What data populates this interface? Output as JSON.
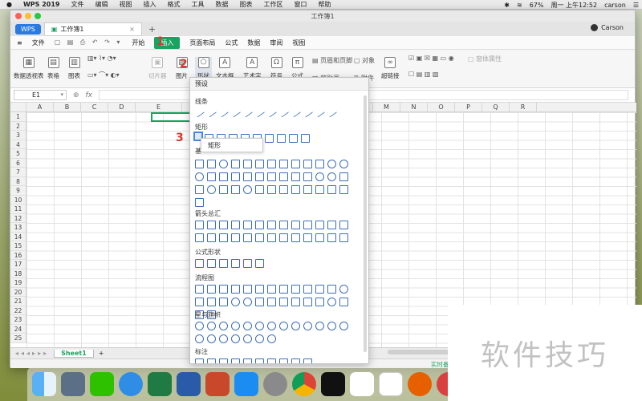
{
  "menubar": {
    "app": "WPS 2019",
    "items": [
      "文件",
      "编辑",
      "视图",
      "插入",
      "格式",
      "工具",
      "数据",
      "图表",
      "工作区",
      "窗口",
      "帮助"
    ],
    "battery": "67%",
    "datetime": "周一 上午12:52",
    "user": "carson"
  },
  "window": {
    "title": "工作簿1",
    "tabs": {
      "wps": "WPS",
      "doc": "工作簿1"
    },
    "user": "Carson"
  },
  "ribbon_tabs": {
    "file": "文件",
    "items": [
      "开始",
      "插入",
      "页面布局",
      "公式",
      "数据",
      "审阅",
      "视图"
    ],
    "active": "插入"
  },
  "ribbon": {
    "pivot": "数据透视表",
    "table": "表格",
    "chart": "图表",
    "slicer": "切片器",
    "picture": "图片",
    "shapes": "形状",
    "textbox": "文本框",
    "wordart": "艺术字",
    "symbol": "符号",
    "formula": "公式",
    "header_footer": "页眉和页脚",
    "object": "对象",
    "attach": "附件",
    "hyperlink": "超链接",
    "window_props": "窗体属性",
    "sticker": "剪贴画"
  },
  "formula_bar": {
    "name_box": "E1",
    "fx": "fx"
  },
  "grid": {
    "columns": [
      "A",
      "B",
      "C",
      "D",
      "E",
      "F",
      "G",
      "H",
      "I",
      "J",
      "K",
      "L",
      "M",
      "N",
      "O",
      "P",
      "Q",
      "R"
    ],
    "rows": [
      "1",
      "2",
      "3",
      "4",
      "5",
      "6",
      "7",
      "8",
      "9",
      "10",
      "11",
      "12",
      "13",
      "14",
      "15",
      "16",
      "17",
      "18",
      "19",
      "20",
      "21",
      "22",
      "23",
      "24",
      "25"
    ]
  },
  "sheets": {
    "active": "Sheet1"
  },
  "status": {
    "save": "实时备份"
  },
  "shapes_popup": {
    "header": "预设",
    "sections": {
      "lines": "线条",
      "rect": "矩形",
      "basic": "基",
      "arrows": "箭头总汇",
      "equation": "公式形状",
      "flowchart": "流程图",
      "stars": "星与旗帜",
      "callouts": "标注"
    },
    "tooltip": "矩形"
  },
  "annotations": {
    "n1": "1",
    "n2": "2",
    "n3": "3"
  },
  "watermark": "软件技巧",
  "colors": {
    "accent": "#1aa260",
    "wps_blue": "#2a7ae2",
    "shape_stroke": "#3d6fb8",
    "marker": "#d23a2e"
  }
}
